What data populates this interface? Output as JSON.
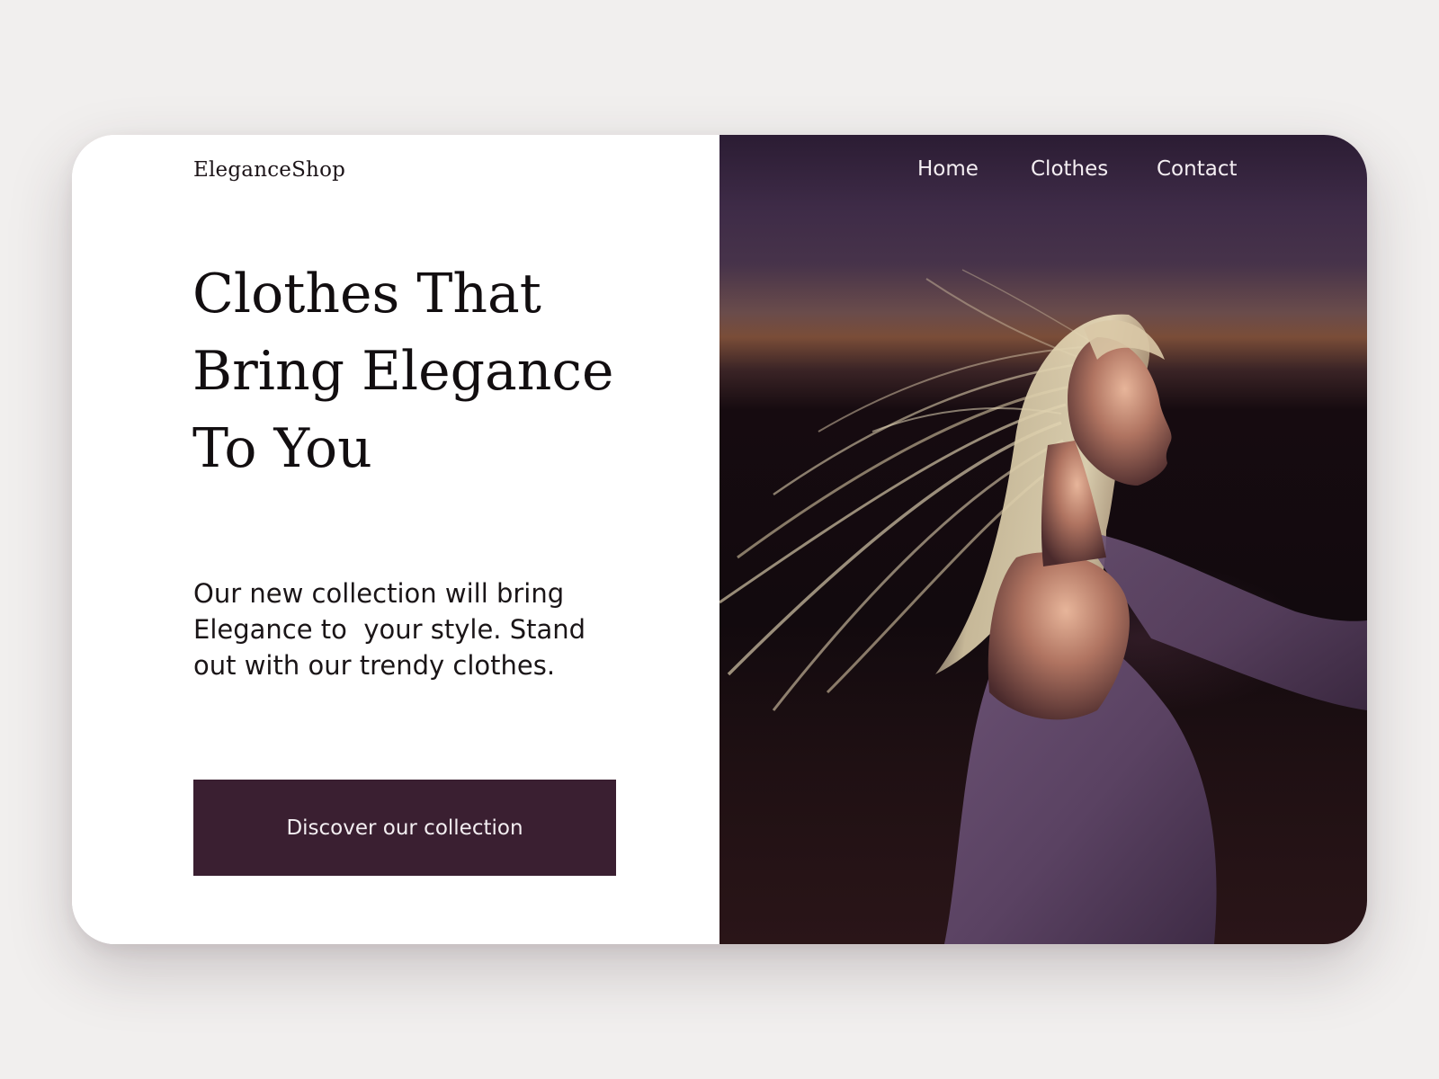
{
  "brand": {
    "name": "EleganceShop"
  },
  "nav": {
    "items": [
      {
        "label": "Home"
      },
      {
        "label": "Clothes"
      },
      {
        "label": "Contact"
      }
    ]
  },
  "hero": {
    "headline_lines": [
      "Clothes That",
      "Bring Elegance",
      "To You"
    ],
    "description_lines": [
      "Our new collection will bring",
      "Elegance to  your style. Stand",
      "out with our trendy clothes."
    ],
    "cta_label": "Discover our collection",
    "image": "woman-with-flowing-blonde-hair-photo"
  },
  "colors": {
    "page_background": "#f1efee",
    "card_background": "#ffffff",
    "button_background": "#3a1f31",
    "button_text": "#f3eef1",
    "heading_text": "#120e10",
    "nav_text": "#f4eef2"
  }
}
